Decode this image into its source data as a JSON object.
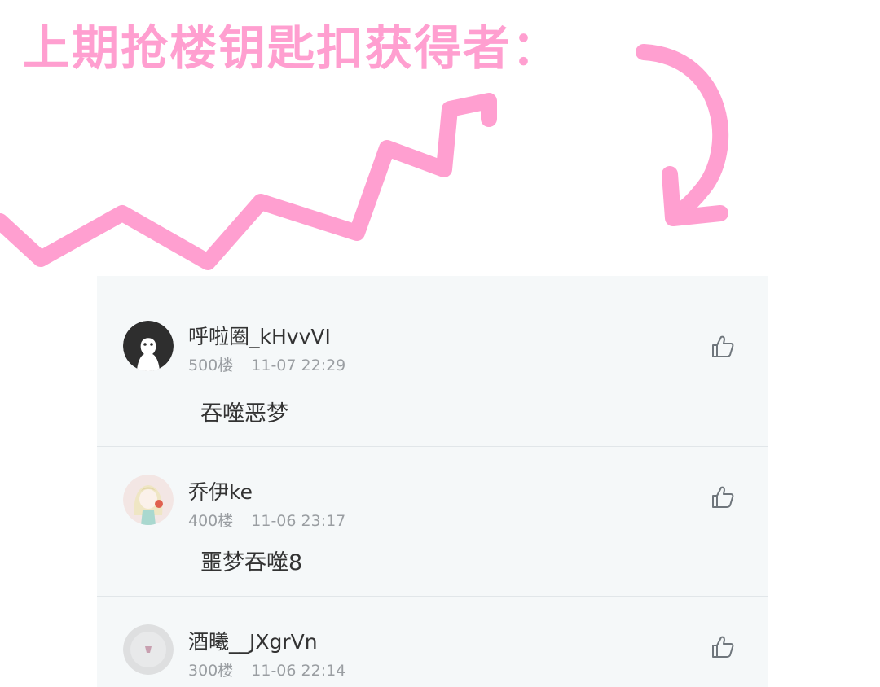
{
  "banner": {
    "title": "上期抢楼钥匙扣获得者：",
    "accent_color": "#ff9fd0"
  },
  "comments": [
    {
      "username": "呼啦圈_kHvvVI",
      "floor": "500楼",
      "time": "11-07 22:29",
      "text": "吞噬恶梦",
      "avatar_icon": "ghost-avatar"
    },
    {
      "username": "乔伊ke",
      "floor": "400楼",
      "time": "11-06 23:17",
      "text": "噩梦吞噬8",
      "avatar_icon": "anime-girl-avatar"
    },
    {
      "username": "酒曦__JXgrVn",
      "floor": "300楼",
      "time": "11-06 22:14",
      "text": "",
      "avatar_icon": "gray-avatar"
    }
  ],
  "icons": {
    "like": "thumbs-up-icon"
  }
}
